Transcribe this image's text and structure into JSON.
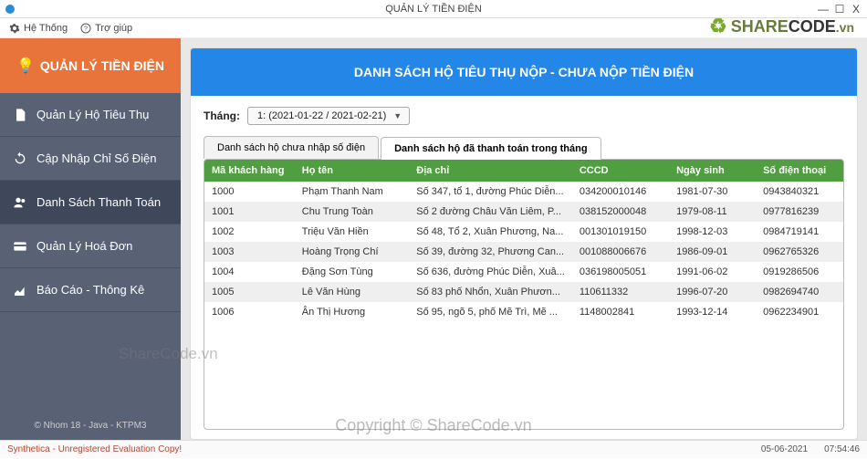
{
  "window": {
    "title": "QUẢN LÝ TIỀN ĐIỆN",
    "minimize": "—",
    "maximize": "☐",
    "close": "X"
  },
  "menubar": {
    "system": "Hệ Thống",
    "help": "Trợ giúp"
  },
  "brand_logo": {
    "share": "SHARE",
    "code": "CODE",
    "vn": ".vn"
  },
  "sidebar": {
    "app_title": "QUẢN LÝ TIỀN ĐIỆN",
    "items": [
      {
        "key": "households",
        "label": "Quản Lý Hộ Tiêu Thụ"
      },
      {
        "key": "meter",
        "label": "Cập Nhập Chỉ Số Điện"
      },
      {
        "key": "payments",
        "label": "Danh Sách Thanh Toán"
      },
      {
        "key": "invoices",
        "label": "Quản Lý Hoá Đơn"
      },
      {
        "key": "reports",
        "label": "Báo Cáo - Thông Kê"
      }
    ],
    "footer": "© Nhom 18 - Java - KTPM3"
  },
  "main": {
    "page_title": "DANH SÁCH HỘ TIÊU THỤ NỘP - CHƯA NỘP TIỀN ĐIỆN",
    "filter": {
      "label": "Tháng:",
      "selected": "1: (2021-01-22 / 2021-02-21)"
    },
    "tabs": [
      {
        "label": "Danh sách hộ chưa nhập số điện",
        "active": false
      },
      {
        "label": "Danh sách hộ đã thanh toán trong tháng",
        "active": true
      }
    ]
  },
  "table": {
    "columns": [
      "Mã khách hàng",
      "Họ tên",
      "Địa chỉ",
      "CCCD",
      "Ngày sinh",
      "Số điện thoại"
    ],
    "rows": [
      [
        "1000",
        "Phạm Thanh Nam",
        "Số 347, tổ 1, đường Phúc Diễn...",
        "034200010146",
        "1981-07-30",
        "0943840321"
      ],
      [
        "1001",
        "Chu Trung Toàn",
        "Số 2 đường Châu Văn Liêm, P...",
        "038152000048",
        "1979-08-11",
        "0977816239"
      ],
      [
        "1002",
        "Triệu Văn Hiền",
        "Số 48, Tổ 2, Xuân Phương, Na...",
        "001301019150",
        "1998-12-03",
        "0984719141"
      ],
      [
        "1003",
        "Hoàng Trọng Chí",
        "Số 39, đường 32, Phương Can...",
        "001088006676",
        "1986-09-01",
        "0962765326"
      ],
      [
        "1004",
        "Đặng Sơn Tùng",
        "Số 636, đường Phúc Diễn, Xuâ...",
        "036198005051",
        "1991-06-02",
        "0919286506"
      ],
      [
        "1005",
        "Lê Văn Hùng",
        "Số 83 phố Nhổn, Xuân Phươn...",
        "110611332",
        "1996-07-20",
        "0982694740"
      ],
      [
        "1006",
        "Ân Thị Hương",
        "Số 95, ngõ 5, phố Mẽ Trì, Mẽ ...",
        "1148002841",
        "1993-12-14",
        "0962234901"
      ]
    ]
  },
  "statusbar": {
    "left": "Synthetica - Unregistered Evaluation Copy!",
    "date": "05-06-2021",
    "time": "07:54:46"
  },
  "watermarks": {
    "left": "ShareCode.vn",
    "center": "Copyright © ShareCode.vn"
  }
}
